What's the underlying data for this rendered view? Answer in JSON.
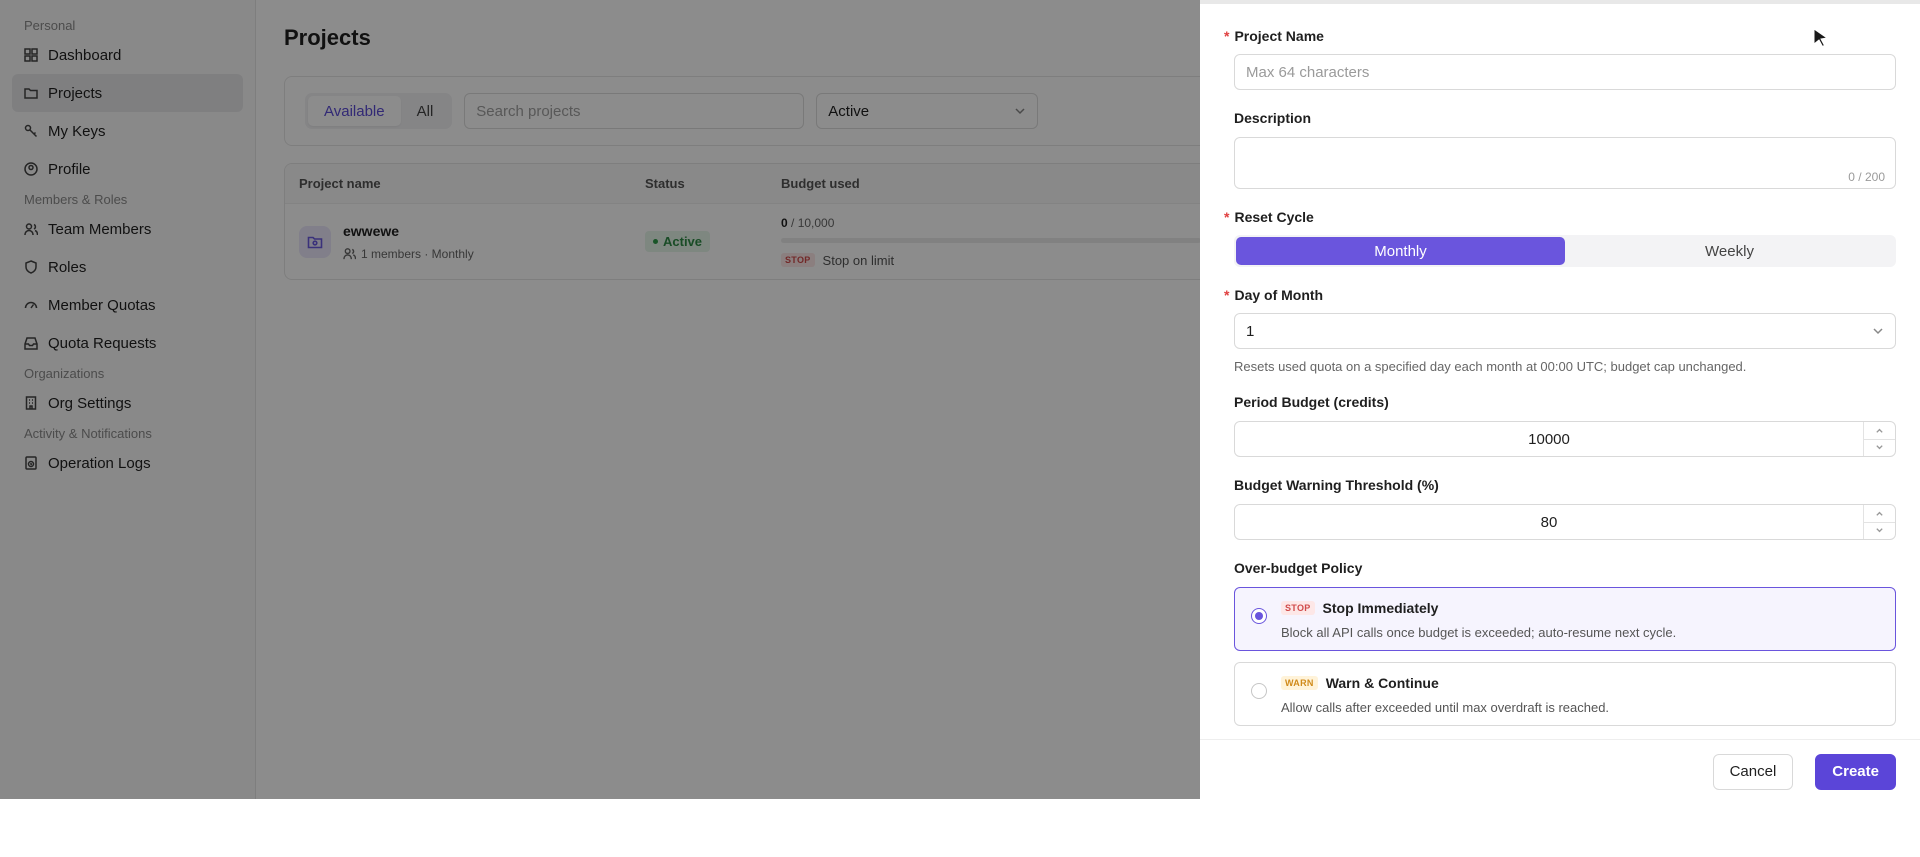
{
  "sidebar": {
    "sections": [
      "Personal",
      "Members & Roles",
      "Organizations",
      "Activity & Notifications"
    ],
    "items": [
      {
        "label": "Dashboard"
      },
      {
        "label": "Projects"
      },
      {
        "label": "My Keys"
      },
      {
        "label": "Profile"
      },
      {
        "label": "Team Members"
      },
      {
        "label": "Roles"
      },
      {
        "label": "Member Quotas"
      },
      {
        "label": "Quota Requests"
      },
      {
        "label": "Org Settings"
      },
      {
        "label": "Operation Logs"
      }
    ]
  },
  "main": {
    "title": "Projects",
    "filters": {
      "tabs": [
        "Available",
        "All"
      ],
      "search_placeholder": "Search projects",
      "status_value": "Active"
    },
    "table": {
      "columns": [
        "Project name",
        "Status",
        "Budget used"
      ],
      "rows": [
        {
          "name": "ewwewe",
          "meta": "1 members · Monthly",
          "status": "Active",
          "used": "0",
          "total": "/ 10,000",
          "used_fraction": 0,
          "policy_tag": "STOP",
          "policy_text": "Stop on limit"
        }
      ]
    }
  },
  "drawer": {
    "project_name": {
      "label": "Project Name",
      "placeholder": "Max 64 characters"
    },
    "description": {
      "label": "Description",
      "counter": "0 / 200"
    },
    "reset_cycle": {
      "label": "Reset Cycle",
      "options": [
        "Monthly",
        "Weekly"
      ],
      "selected": "Monthly"
    },
    "day_of_month": {
      "label": "Day of Month",
      "value": "1",
      "help": "Resets used quota on a specified day each month at 00:00 UTC; budget cap unchanged."
    },
    "period_budget": {
      "label": "Period Budget (credits)",
      "value": "10000"
    },
    "warning_threshold": {
      "label": "Budget Warning Threshold (%)",
      "value": "80"
    },
    "over_budget": {
      "label": "Over-budget Policy",
      "options": [
        {
          "tag": "STOP",
          "title": "Stop Immediately",
          "desc": "Block all API calls once budget is exceeded; auto-resume next cycle.",
          "selected": true
        },
        {
          "tag": "WARN",
          "title": "Warn & Continue",
          "desc": "Allow calls after exceeded until max overdraft is reached.",
          "selected": false
        }
      ]
    },
    "buttons": {
      "cancel": "Cancel",
      "create": "Create"
    }
  },
  "colors": {
    "accent": "#6a55dd",
    "primary_button": "#5b45d8",
    "active_green": "#2e8b45",
    "stop_red": "#d04a4a",
    "warn_orange": "#d08a1a"
  }
}
